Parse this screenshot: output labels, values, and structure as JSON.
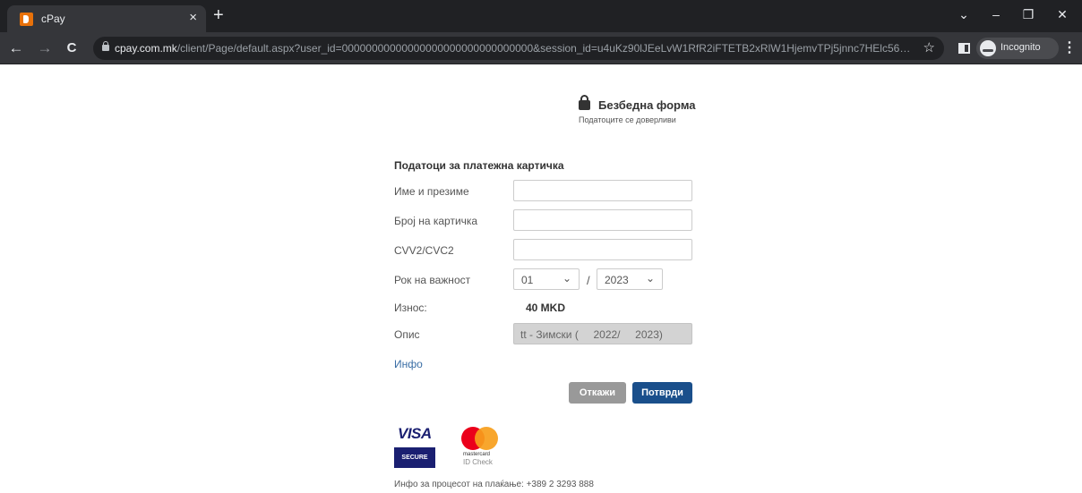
{
  "browser": {
    "tab_title": "cPay",
    "tab_close": "×",
    "new_tab": "+",
    "url_host": "cpay.com.mk",
    "url_path": "/client/Page/default.aspx?user_id=00000000000000000000000000000000&session_id=u4uKz90lJEeLvW1RfR2iFTETB2xRlW1HjemvTPj5jnnc7HElc56E...",
    "incognito_label": "Incognito",
    "controls": {
      "minimize": "–",
      "maximize": "❐",
      "close": "✕",
      "tab_search": "⌄"
    },
    "nav": {
      "back": "←",
      "forward": "→",
      "reload": "C",
      "star": "☆",
      "menu": "⋮"
    }
  },
  "secure": {
    "title": "Безбедна форма",
    "subtitle": "Податоците се доверливи"
  },
  "form": {
    "section_title": "Податоци за платежна картичка",
    "name_label": "Име и презиме",
    "card_label": "Број на картичка",
    "cvv_label": "CVV2/CVC2",
    "expiry_label": "Рок на важност",
    "expiry_month": "01",
    "expiry_separator": "/",
    "expiry_year": "2023",
    "chevron": "⌄",
    "amount_label": "Износ:",
    "amount_value": "40 MKD",
    "desc_label": "Опис",
    "desc_value": "tt - Зимски (     2022/     2023)",
    "info_link": "Инфо",
    "cancel_button": "Откажи",
    "confirm_button": "Потврди"
  },
  "logos": {
    "visa_word": "VISA",
    "visa_secure": "SECURE",
    "mc_word": "mastercard",
    "mc_idcheck": "ID Check"
  },
  "footer": {
    "info": "Инфо за процесот на плаќање: +389 2 3293 888"
  }
}
